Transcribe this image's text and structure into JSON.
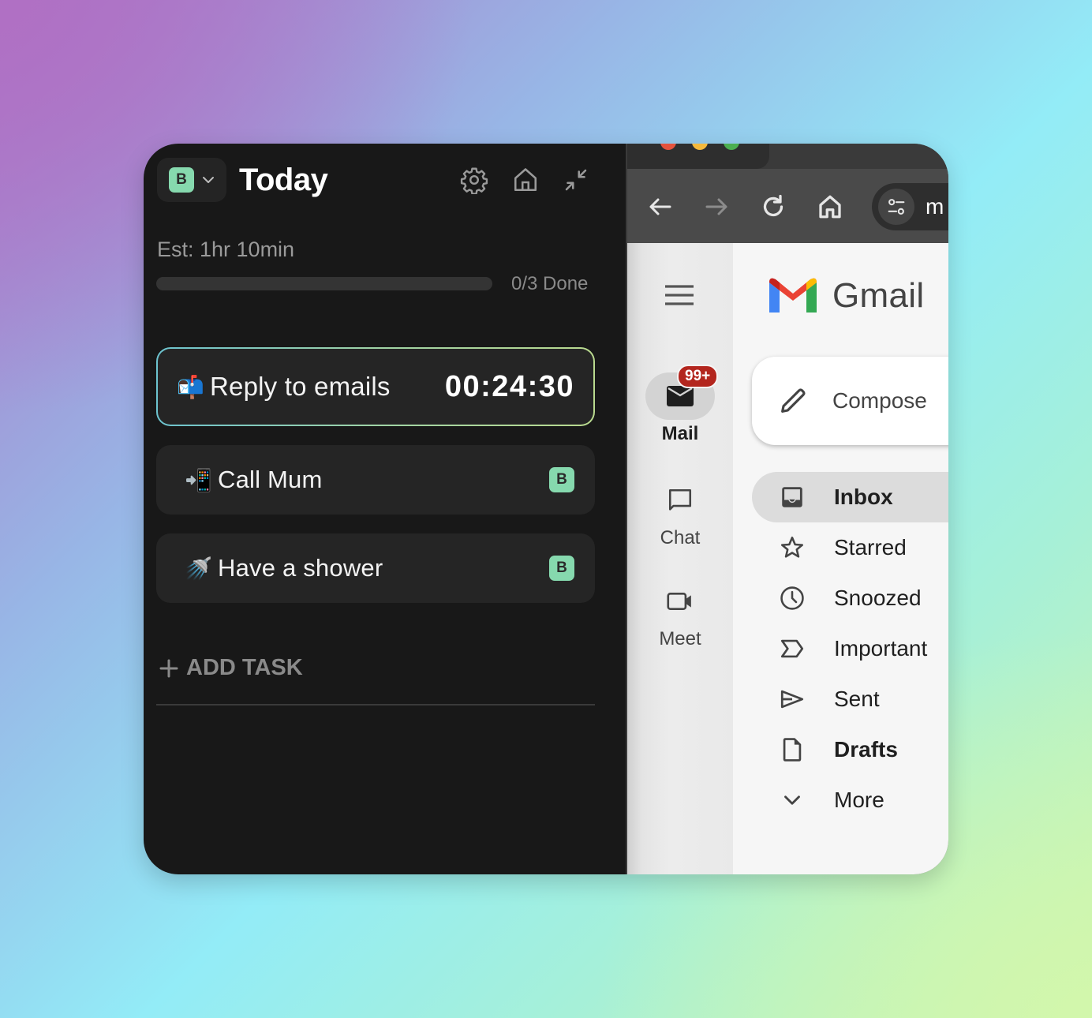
{
  "task_panel": {
    "workspace_badge": "B",
    "title": "Today",
    "estimate": "Est: 1hr 10min",
    "progress_fraction": 0,
    "done_text": "0/3 Done",
    "tasks": [
      {
        "emoji": "📬",
        "label": "Reply to emails",
        "timer": "00:24:30",
        "active": true
      },
      {
        "emoji": "📲",
        "label": "Call Mum",
        "badge": "B",
        "active": false
      },
      {
        "emoji": "🚿",
        "label": "Have a shower",
        "badge": "B",
        "active": false
      }
    ],
    "add_task_label": "ADD TASK",
    "icons": [
      "gear-icon",
      "home-icon",
      "collapse-icon"
    ]
  },
  "browser": {
    "omnibox_text": "m",
    "traffic_colors": [
      "#e5533d",
      "#f5b93c",
      "#4caf50"
    ]
  },
  "gmail": {
    "logo_text": "Gmail",
    "compose_label": "Compose",
    "rail": [
      {
        "label": "Mail",
        "badge": "99+",
        "active": true
      },
      {
        "label": "Chat",
        "active": false
      },
      {
        "label": "Meet",
        "active": false
      }
    ],
    "nav": [
      {
        "label": "Inbox",
        "icon": "inbox-icon",
        "active": true,
        "bold": true
      },
      {
        "label": "Starred",
        "icon": "star-icon",
        "active": false,
        "bold": false
      },
      {
        "label": "Snoozed",
        "icon": "clock-icon",
        "active": false,
        "bold": false
      },
      {
        "label": "Important",
        "icon": "important-icon",
        "active": false,
        "bold": false
      },
      {
        "label": "Sent",
        "icon": "send-icon",
        "active": false,
        "bold": false
      },
      {
        "label": "Drafts",
        "icon": "draft-icon",
        "active": false,
        "bold": true
      },
      {
        "label": "More",
        "icon": "chevron-down-icon",
        "active": false,
        "bold": false
      }
    ],
    "badge_color": "#b3261e"
  }
}
